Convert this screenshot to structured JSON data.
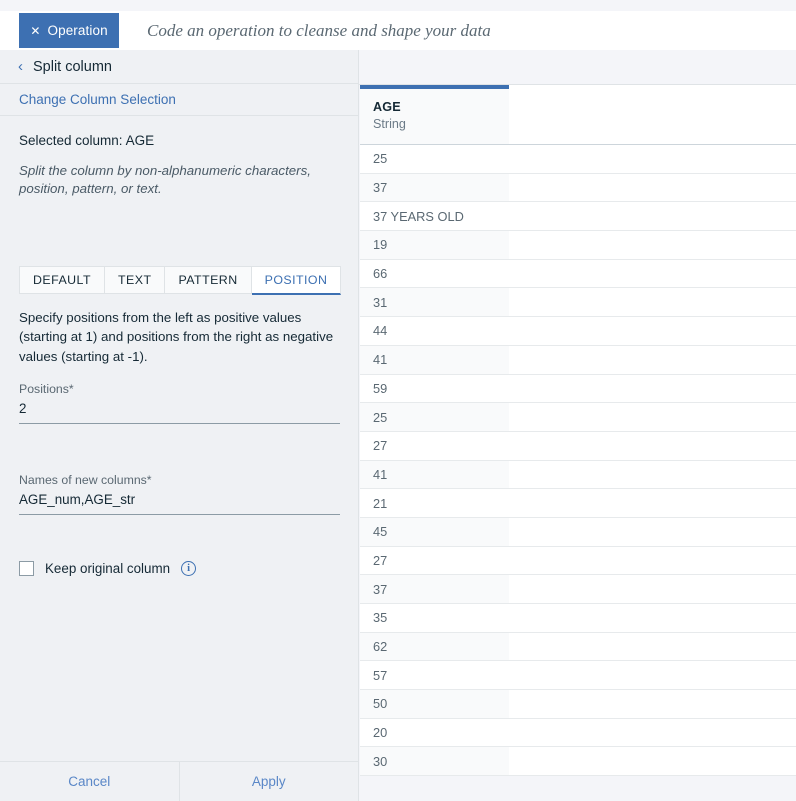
{
  "topbar": {
    "operation_tab_label": "Operation",
    "operation_tab_close_icon": "close-icon",
    "prompt_placeholder": "Code an operation to cleanse and shape your data"
  },
  "panel": {
    "back_icon": "chevron-left-icon",
    "title": "Split column",
    "change_selection_link": "Change Column Selection",
    "selected_column": "Selected column: AGE",
    "description": "Split the column by non-alphanumeric characters, position, pattern, or text.",
    "tabs": [
      {
        "label": "DEFAULT",
        "active": false
      },
      {
        "label": "TEXT",
        "active": false
      },
      {
        "label": "PATTERN",
        "active": false
      },
      {
        "label": "POSITION",
        "active": true
      }
    ],
    "hint": "Specify positions from the left as positive values (starting at 1) and positions from the right as negative values (starting at -1).",
    "fields": {
      "positions": {
        "label": "Positions*",
        "value": "2"
      },
      "names": {
        "label": "Names of new columns*",
        "value": "AGE_num,AGE_str"
      }
    },
    "keep_original": {
      "label": "Keep original column",
      "checked": false,
      "info_icon": "info-icon"
    },
    "footer": {
      "cancel_label": "Cancel",
      "apply_label": "Apply"
    }
  },
  "table": {
    "column": {
      "name": "AGE",
      "type": "String"
    },
    "values": [
      "25",
      "37",
      "37 YEARS OLD",
      "19",
      "66",
      "31",
      "44",
      "41",
      "59",
      "25",
      "27",
      "41",
      "21",
      "45",
      "27",
      "37",
      "35",
      "62",
      "57",
      "50",
      "20",
      "30"
    ]
  },
  "colors": {
    "accent_blue": "#3d70b2",
    "panel_bg": "#eff1f4",
    "page_bg": "#f4f5f9",
    "link_blue": "#5a87c7",
    "border": "#dfe3e6"
  }
}
